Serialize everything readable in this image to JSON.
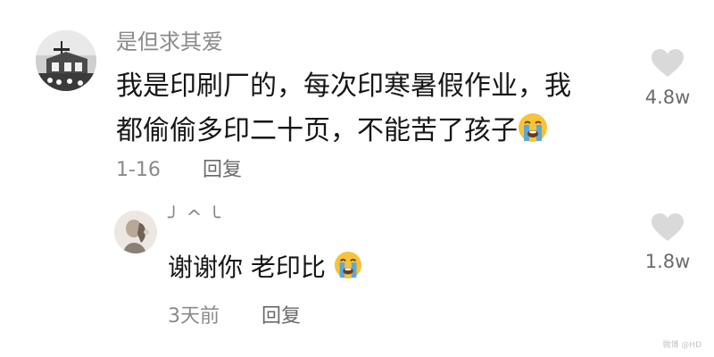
{
  "comments": [
    {
      "username": "是但求其爱",
      "text_lines": [
        "我是印刷厂的，每次印寒暑假作业，我",
        "都偷偷多印二十页，不能苦了孩子"
      ],
      "date": "1-16",
      "reply_label": "回复",
      "likes": "4.8w",
      "emoji": "loudly-crying-face"
    }
  ],
  "replies": [
    {
      "username": "╯ ^ ╰",
      "text": "谢谢你 老印比",
      "date": "3天前",
      "reply_label": "回复",
      "likes": "1.8w",
      "emoji": "loudly-crying-face"
    }
  ],
  "watermark": "微博 @HD",
  "colors": {
    "text": "#161616",
    "meta": "#8a8a8a",
    "heart": "#d9d9d9",
    "emoji_face": "#f6c33a",
    "emoji_tears": "#4aa5e8"
  }
}
